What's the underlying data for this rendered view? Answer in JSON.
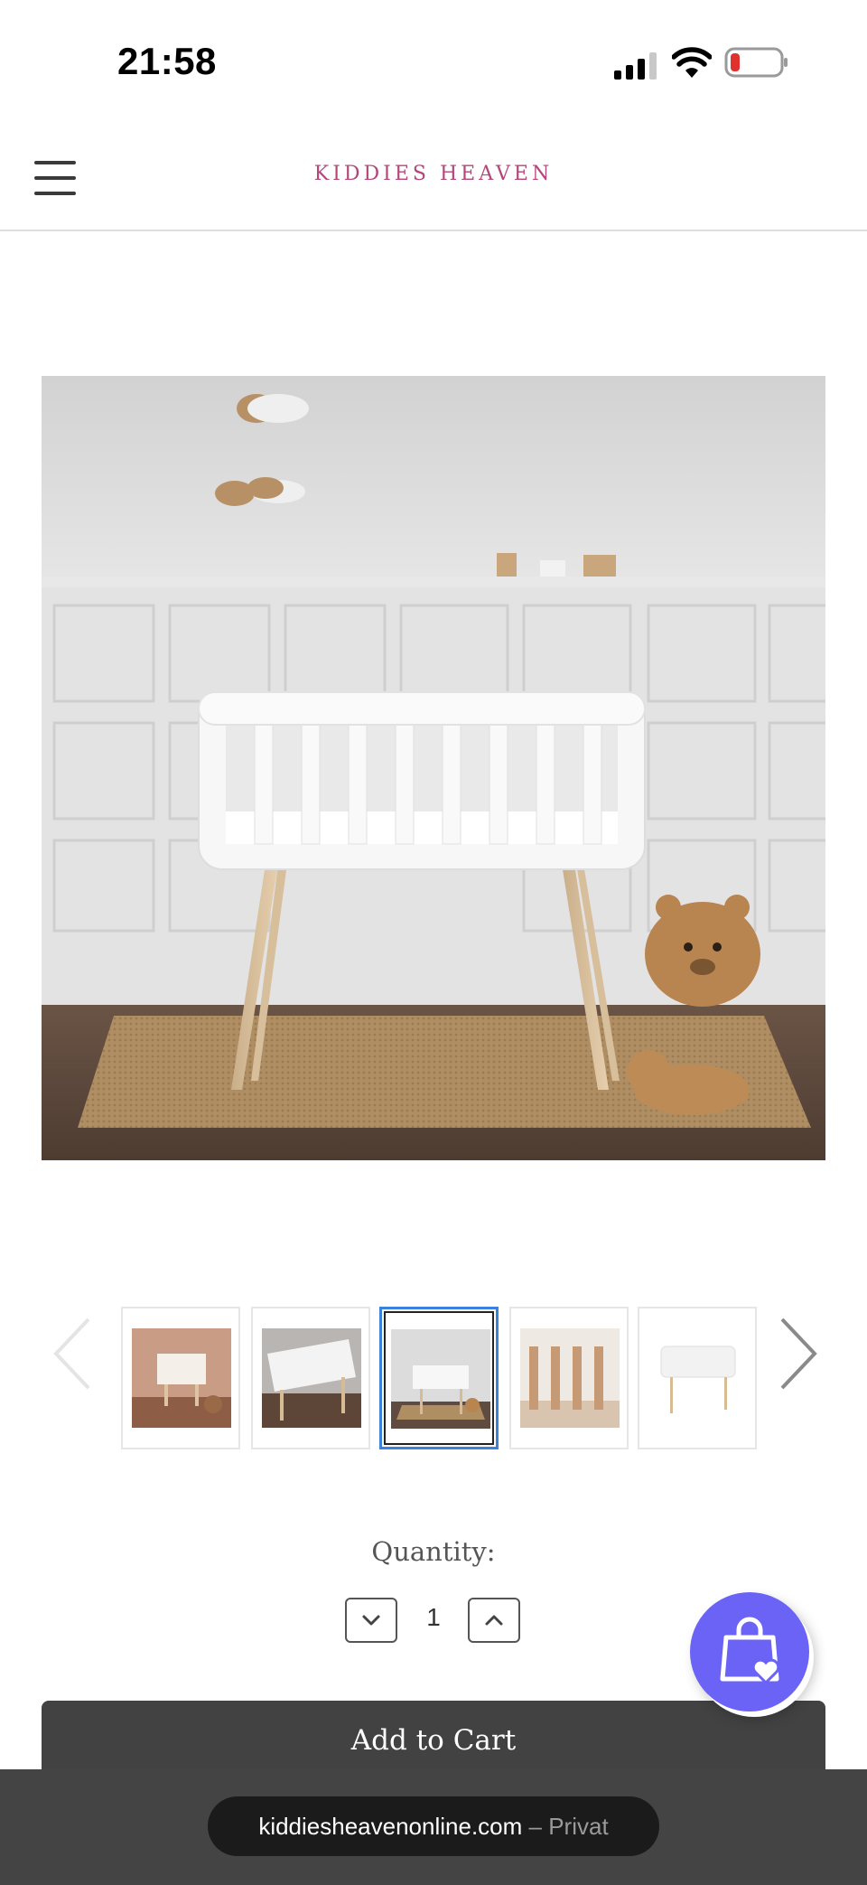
{
  "status_bar": {
    "time": "21:58",
    "icons": [
      "signal-icon",
      "wifi-icon",
      "battery-icon"
    ],
    "battery_color": "#e0312f"
  },
  "header": {
    "brand": "KIDDIES HEAVEN",
    "brand_color": "#b3477a",
    "menu_icon": "hamburger-menu-icon"
  },
  "product": {
    "hero_image": "white-crib-on-wooden-legs-with-teddy-bear-basket",
    "thumbnails": [
      {
        "name": "thumb-crib-warm-room"
      },
      {
        "name": "thumb-crib-angled"
      },
      {
        "name": "thumb-crib-front",
        "active": true
      },
      {
        "name": "thumb-crib-closeup"
      },
      {
        "name": "thumb-crib-white-background"
      }
    ],
    "quantity_label": "Quantity:",
    "quantity_value": "1",
    "add_to_cart_label": "Add to Cart"
  },
  "colors": {
    "active_thumb_border": "#3b82dc",
    "fab_color": "#6a63f5",
    "cart_button": "#424242"
  },
  "browser": {
    "domain": "kiddiesheavenonline.com",
    "separator": " – ",
    "mode": "Privat"
  }
}
